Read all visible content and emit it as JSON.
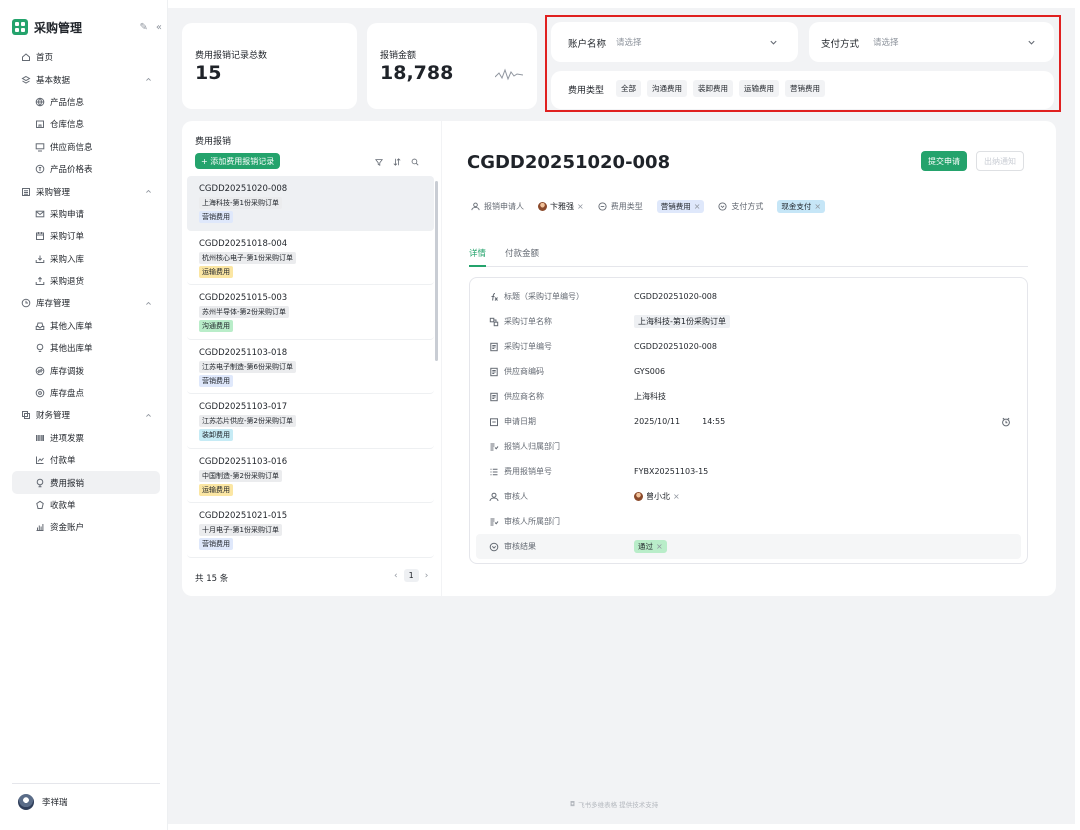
{
  "app": {
    "title": "采购管理"
  },
  "sidebar": {
    "items": [
      {
        "label": "首页",
        "icon": "home-icon",
        "level": 0
      },
      {
        "label": "基本数据",
        "icon": "layers-icon",
        "level": 0,
        "group": true
      },
      {
        "label": "产品信息",
        "icon": "globe-icon",
        "level": 1
      },
      {
        "label": "仓库信息",
        "icon": "warehouse-icon",
        "level": 1
      },
      {
        "label": "供应商信息",
        "icon": "monitor-icon",
        "level": 1
      },
      {
        "label": "产品价格表",
        "icon": "coin-icon",
        "level": 1
      },
      {
        "label": "采购管理",
        "icon": "list-icon",
        "level": 0,
        "group": true
      },
      {
        "label": "采购申请",
        "icon": "mail-icon",
        "level": 1
      },
      {
        "label": "采购订单",
        "icon": "calendar-icon",
        "level": 1
      },
      {
        "label": "采购入库",
        "icon": "box-in-icon",
        "level": 1
      },
      {
        "label": "采购退货",
        "icon": "box-out-icon",
        "level": 1
      },
      {
        "label": "库存管理",
        "icon": "clock-icon",
        "level": 0,
        "group": true
      },
      {
        "label": "其他入库单",
        "icon": "inbox-icon",
        "level": 1
      },
      {
        "label": "其他出库单",
        "icon": "bulb-icon",
        "level": 1
      },
      {
        "label": "库存调拨",
        "icon": "transfer-icon",
        "level": 1
      },
      {
        "label": "库存盘点",
        "icon": "settings-icon",
        "level": 1
      },
      {
        "label": "财务管理",
        "icon": "copy-icon",
        "level": 0,
        "group": true
      },
      {
        "label": "进项发票",
        "icon": "barcode-icon",
        "level": 1
      },
      {
        "label": "付款单",
        "icon": "payment-icon",
        "level": 1
      },
      {
        "label": "费用报销",
        "icon": "reimburse-icon",
        "level": 1,
        "active": true
      },
      {
        "label": "收款单",
        "icon": "receipt-icon",
        "level": 1
      },
      {
        "label": "资金账户",
        "icon": "chart-icon",
        "level": 1
      }
    ],
    "user": "李祥瑞"
  },
  "stats": {
    "count_label": "费用报销记录总数",
    "count_value": "15",
    "amount_label": "报销金额",
    "amount_value": "18,788"
  },
  "filters": {
    "account_label": "账户名称",
    "account_placeholder": "请选择",
    "pay_label": "支付方式",
    "pay_placeholder": "请选择",
    "type_label": "费用类型",
    "type_options": [
      "全部",
      "沟通费用",
      "装卸费用",
      "运输费用",
      "营销费用"
    ]
  },
  "list": {
    "title": "费用报销",
    "add_label": "+ 添加费用报销记录",
    "total": "共 15 条",
    "page": "1",
    "items": [
      {
        "code": "CGDD20251020-008",
        "sub": "上海科技-第1份采购订单",
        "tag": "营销费用",
        "color": "blue"
      },
      {
        "code": "CGDD20251018-004",
        "sub": "杭州核心电子-第1份采购订单",
        "tag": "运输费用",
        "color": "yellow"
      },
      {
        "code": "CGDD20251015-003",
        "sub": "苏州半导体-第2份采购订单",
        "tag": "沟通费用",
        "color": "green"
      },
      {
        "code": "CGDD20251103-018",
        "sub": "江苏电子制造-第6份采购订单",
        "tag": "营销费用",
        "color": "blue"
      },
      {
        "code": "CGDD20251103-017",
        "sub": "江苏芯片供应-第2份采购订单",
        "tag": "装卸费用",
        "color": "cyan"
      },
      {
        "code": "CGDD20251103-016",
        "sub": "中国制造-第2份采购订单",
        "tag": "运输费用",
        "color": "yellow"
      },
      {
        "code": "CGDD20251021-015",
        "sub": "十月电子-第1份采购订单",
        "tag": "营销费用",
        "color": "blue"
      }
    ]
  },
  "detail": {
    "title": "CGDD20251020-008",
    "submit_label": "提交申请",
    "pay_notice_label": "出纳通知",
    "meta": {
      "applicant_label": "报销申请人",
      "applicant": "卞雅强",
      "type_label": "费用类型",
      "type_value": "营销费用",
      "pay_label": "支付方式",
      "pay_value": "现金支付"
    },
    "tabs": [
      "详情",
      "付款金额"
    ],
    "fields": [
      {
        "icon": "formula-icon",
        "label": "标题（采购订单编号）",
        "value": "CGDD20251020-008"
      },
      {
        "icon": "link-icon",
        "label": "采购订单名称",
        "value": "上海科技-第1份采购订单",
        "tag": true
      },
      {
        "icon": "doc-icon",
        "label": "采购订单编号",
        "value": "CGDD20251020-008"
      },
      {
        "icon": "doc-icon",
        "label": "供应商编码",
        "value": "GYS006"
      },
      {
        "icon": "doc-icon",
        "label": "供应商名称",
        "value": "上海科技"
      },
      {
        "icon": "date-icon",
        "label": "申请日期",
        "value": "2025/10/11",
        "time": "14:55"
      },
      {
        "icon": "dept-icon",
        "label": "报销人归属部门",
        "value": ""
      },
      {
        "icon": "list-num-icon",
        "label": "费用报销单号",
        "value": "FYBX20251103-15"
      },
      {
        "icon": "person-icon",
        "label": "审核人",
        "value": "曾小北",
        "person": true
      },
      {
        "icon": "dept-icon",
        "label": "审核人所属部门",
        "value": ""
      },
      {
        "icon": "radio-icon",
        "label": "审核结果",
        "value": "通过",
        "pill": true
      }
    ]
  },
  "footer": "飞书多维表格 提供技术支持",
  "colors": {
    "accent": "#24a36c",
    "highlight": "#e02020"
  }
}
